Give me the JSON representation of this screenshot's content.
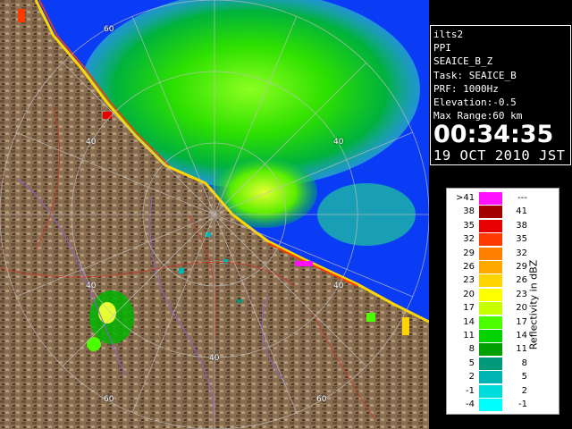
{
  "info": {
    "host": "ilts2",
    "product": "PPI",
    "name": "SEAICE_B_Z",
    "task": "Task: SEAICE_B",
    "prf": "PRF: 1000Hz",
    "elevation": "Elevation:-0.5",
    "max_range": "Max Range:60 km",
    "time": "00:34:35",
    "date": "19 OCT 2010 JST"
  },
  "map": {
    "range_labels": [
      "60",
      "40",
      "40",
      "40",
      "40",
      "40",
      "60",
      "60"
    ],
    "colors": {
      "sea": "#0a3cf5",
      "land": "#8a6f52",
      "coast": "#ffd700",
      "rings": "#c0c0c0"
    }
  },
  "legend": {
    "title": "Reflectivity in dBZ",
    "rows": [
      {
        "lo": ">41",
        "hi": "---",
        "color": "#ff10ff"
      },
      {
        "lo": "38",
        "hi": "41",
        "color": "#a30000"
      },
      {
        "lo": "35",
        "hi": "38",
        "color": "#e60000"
      },
      {
        "lo": "32",
        "hi": "35",
        "color": "#ff3a00"
      },
      {
        "lo": "29",
        "hi": "32",
        "color": "#ff8000"
      },
      {
        "lo": "26",
        "hi": "29",
        "color": "#ffa800"
      },
      {
        "lo": "23",
        "hi": "26",
        "color": "#ffd400"
      },
      {
        "lo": "20",
        "hi": "23",
        "color": "#ffff00"
      },
      {
        "lo": "17",
        "hi": "20",
        "color": "#c8ff00"
      },
      {
        "lo": "14",
        "hi": "17",
        "color": "#4cff00"
      },
      {
        "lo": "11",
        "hi": "14",
        "color": "#00d200"
      },
      {
        "lo": "8",
        "hi": "11",
        "color": "#00a000"
      },
      {
        "lo": "5",
        "hi": "8",
        "color": "#009a7a"
      },
      {
        "lo": "2",
        "hi": "5",
        "color": "#00b4b4"
      },
      {
        "lo": "-1",
        "hi": "2",
        "color": "#00dcdc"
      },
      {
        "lo": "-4",
        "hi": "-1",
        "color": "#00ffff"
      }
    ]
  }
}
